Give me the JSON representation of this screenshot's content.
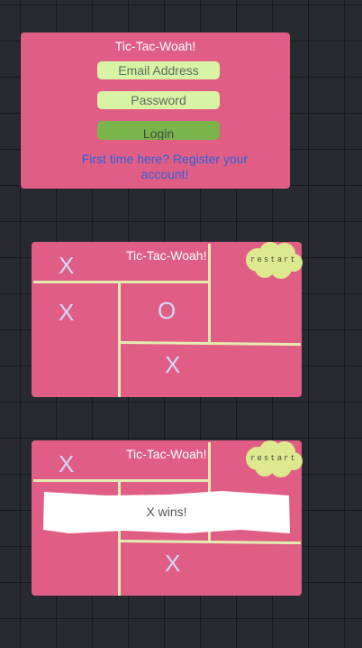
{
  "app_title": "Tic-Tac-Woah!",
  "login": {
    "title": "Tic-Tac-Woah!",
    "email_placeholder": "Email Address",
    "password_placeholder": "Password",
    "login_label": "Login",
    "register_link": "First time here? Register your account!"
  },
  "boards": [
    {
      "title": "Tic-Tac-Woah!",
      "restart_label": "restart",
      "marks": [
        "X",
        "X",
        "O",
        "X"
      ]
    },
    {
      "title": "Tic-Tac-Woah!",
      "restart_label": "restart",
      "marks": [
        "X",
        "X"
      ],
      "result": "X wins!"
    }
  ],
  "colors": {
    "background": "#272a30",
    "card": "#e05e86",
    "field": "#d8f3a4",
    "login_button": "#7ab44a",
    "grid_line": "#e4ecb0",
    "mark": "#d3d9f5",
    "link": "#2f60d8"
  },
  "icons": [
    "cloud-icon"
  ]
}
